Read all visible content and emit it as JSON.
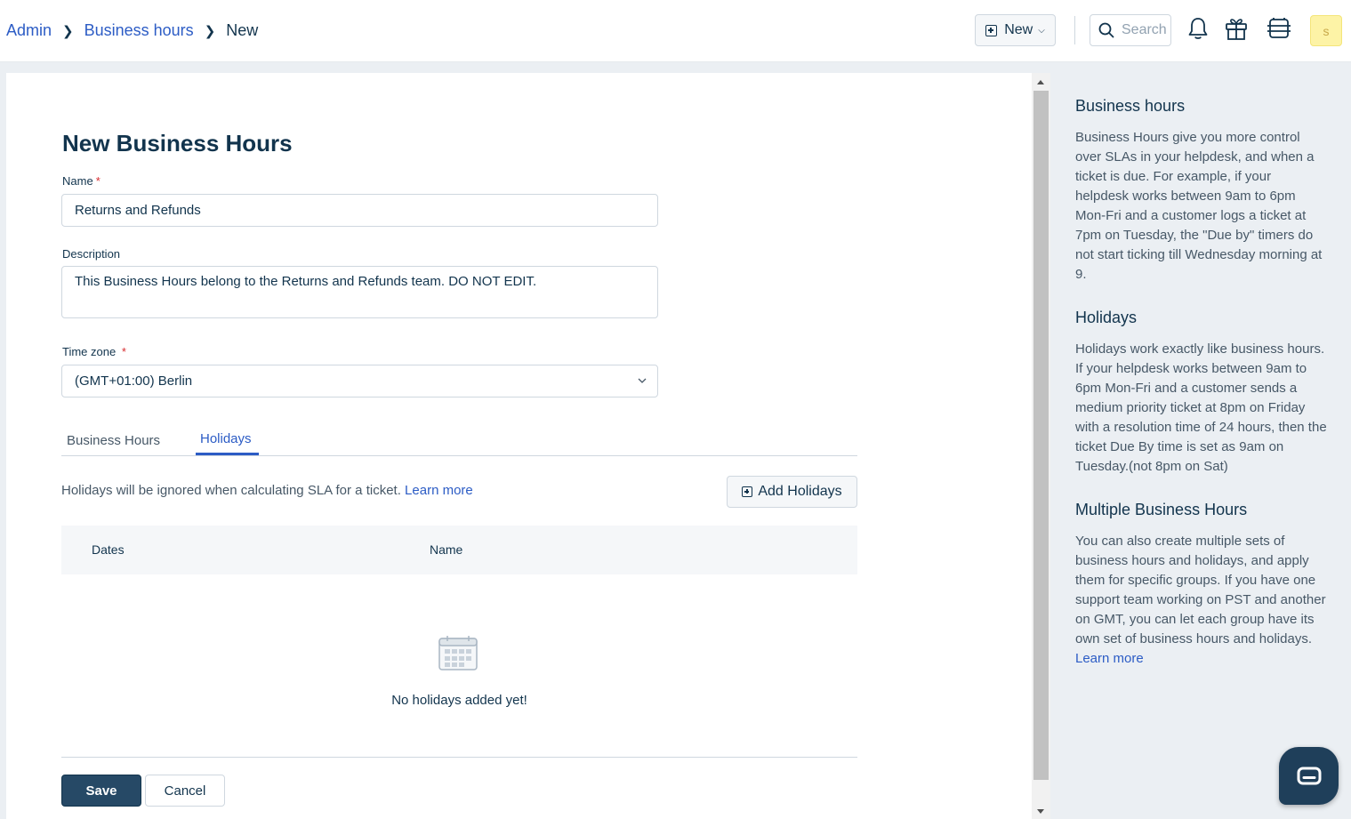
{
  "breadcrumb": {
    "admin": "Admin",
    "business_hours": "Business hours",
    "current": "New"
  },
  "header": {
    "new_button": "New",
    "search_placeholder": "Search",
    "avatar_initial": "s"
  },
  "form": {
    "title": "New Business Hours",
    "name_label": "Name",
    "name_value": "Returns and Refunds",
    "description_label": "Description",
    "description_value": "This Business Hours belong to the Returns and Refunds team. DO NOT EDIT.",
    "timezone_label": "Time zone",
    "timezone_value": "(GMT+01:00) Berlin",
    "required_mark": "*"
  },
  "tabs": [
    {
      "label": "Business Hours",
      "active": false
    },
    {
      "label": "Holidays",
      "active": true
    }
  ],
  "holidays": {
    "help_text": "Holidays will be ignored when calculating SLA for a ticket.",
    "learn_more": "Learn more",
    "add_button": "Add Holidays",
    "columns": [
      "Dates",
      "Name"
    ],
    "empty_text": "No holidays added yet!"
  },
  "actions": {
    "save": "Save",
    "cancel": "Cancel"
  },
  "sidebar": {
    "sections": [
      {
        "title": "Business hours",
        "body": "Business Hours give you more control over SLAs in your helpdesk, and when a ticket is due. For example, if your helpdesk works between 9am to 6pm Mon-Fri and a customer logs a ticket at 7pm on Tuesday, the \"Due by\" timers do not start ticking till Wednesday morning at 9."
      },
      {
        "title": "Holidays",
        "body": "Holidays work exactly like business hours. If your helpdesk works between 9am to 6pm Mon-Fri and a customer sends a medium priority ticket at 8pm on Friday with a resolution time of 24 hours, then the ticket Due By time is set as 9am on Tuesday.(not 8pm on Sat)"
      },
      {
        "title": "Multiple Business Hours",
        "body": "You can also create multiple sets of business hours and holidays, and apply them for specific groups. If you have one support team working on PST and another on GMT, you can let each group have its own set of business hours and holidays.",
        "link": "Learn more"
      }
    ]
  },
  "colors": {
    "primary_text": "#12344d",
    "link": "#2c5cc5",
    "save_button": "#264966",
    "required": "#d72d30",
    "avatar_bg": "#fdf3a6"
  }
}
